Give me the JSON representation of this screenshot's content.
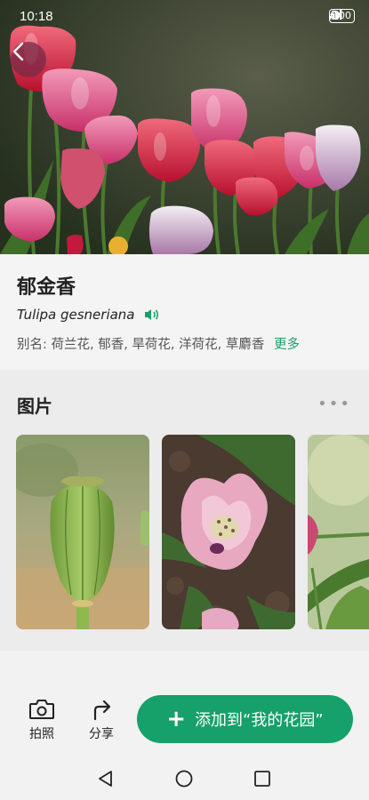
{
  "status_bar": {
    "time": "10:18",
    "battery": "100"
  },
  "plant": {
    "name": "郁金香",
    "latin_name": "Tulipa gesneriana",
    "alias_label": "别名:",
    "aliases": "荷兰花, 郁香, 旱荷花, 洋荷花, 草麝香",
    "more_label": "更多"
  },
  "pictures": {
    "title": "图片",
    "more": "•••"
  },
  "bottom_bar": {
    "photo_label": "拍照",
    "share_label": "分享",
    "add_label": "添加到“我的花园”",
    "plus": "+"
  },
  "icons": {
    "back": "back-arrow-icon",
    "speaker": "speaker-icon",
    "camera": "camera-icon",
    "share": "share-icon",
    "nav_back": "triangle-back-icon",
    "nav_home": "circle-home-icon",
    "nav_recent": "square-recent-icon"
  },
  "colors": {
    "accent_green": "#16a06a",
    "back_button": "#782846"
  }
}
